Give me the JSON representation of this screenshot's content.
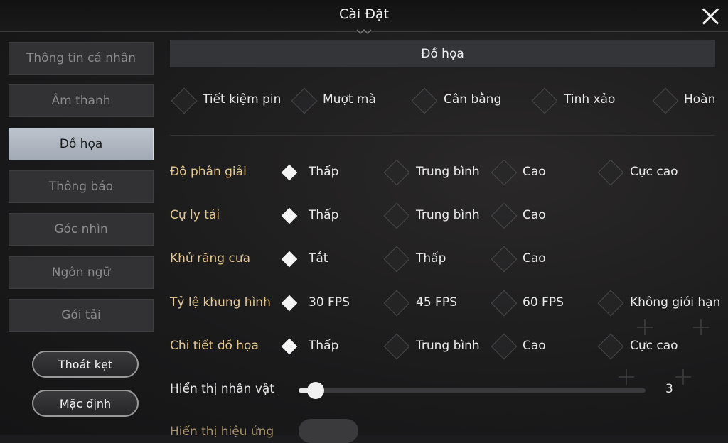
{
  "header": {
    "title": "Cài Đặt"
  },
  "sidebar": {
    "items": [
      {
        "label": "Thông tin cá nhân",
        "active": false
      },
      {
        "label": "Âm thanh",
        "active": false
      },
      {
        "label": "Đồ họa",
        "active": true
      },
      {
        "label": "Thông báo",
        "active": false
      },
      {
        "label": "Góc nhìn",
        "active": false
      },
      {
        "label": "Ngôn ngữ",
        "active": false
      },
      {
        "label": "Gói tải",
        "active": false
      }
    ],
    "exit_button": "Thoát kẹt",
    "default_button": "Mặc định"
  },
  "main": {
    "section_title": "Đồ họa",
    "presets": [
      "Tiết kiệm pin",
      "Mượt mà",
      "Cân bằng",
      "Tinh xảo",
      "Hoàn"
    ],
    "rows": [
      {
        "label": "Độ phân giải",
        "options": [
          "Thấp",
          "Trung bình",
          "Cao",
          "Cực cao"
        ],
        "selected": 0
      },
      {
        "label": "Cự ly tải",
        "options": [
          "Thấp",
          "Trung bình",
          "Cao"
        ],
        "selected": 0
      },
      {
        "label": "Khử răng cưa",
        "options": [
          "Tắt",
          "Thấp",
          "Cao"
        ],
        "selected": 0
      },
      {
        "label": "Tỷ lệ khung hình",
        "options": [
          "30 FPS",
          "45 FPS",
          "60 FPS",
          "Không giới hạn"
        ],
        "selected": 0
      },
      {
        "label": "Chi tiết đồ họa",
        "options": [
          "Thấp",
          "Trung bình",
          "Cao",
          "Cực cao"
        ],
        "selected": 0
      }
    ],
    "slider": {
      "label": "Hiển thị nhân vật",
      "value": "3",
      "fill_fraction": 0.05
    },
    "partial_row": {
      "label": "Hiển thị hiệu ứng"
    }
  }
}
